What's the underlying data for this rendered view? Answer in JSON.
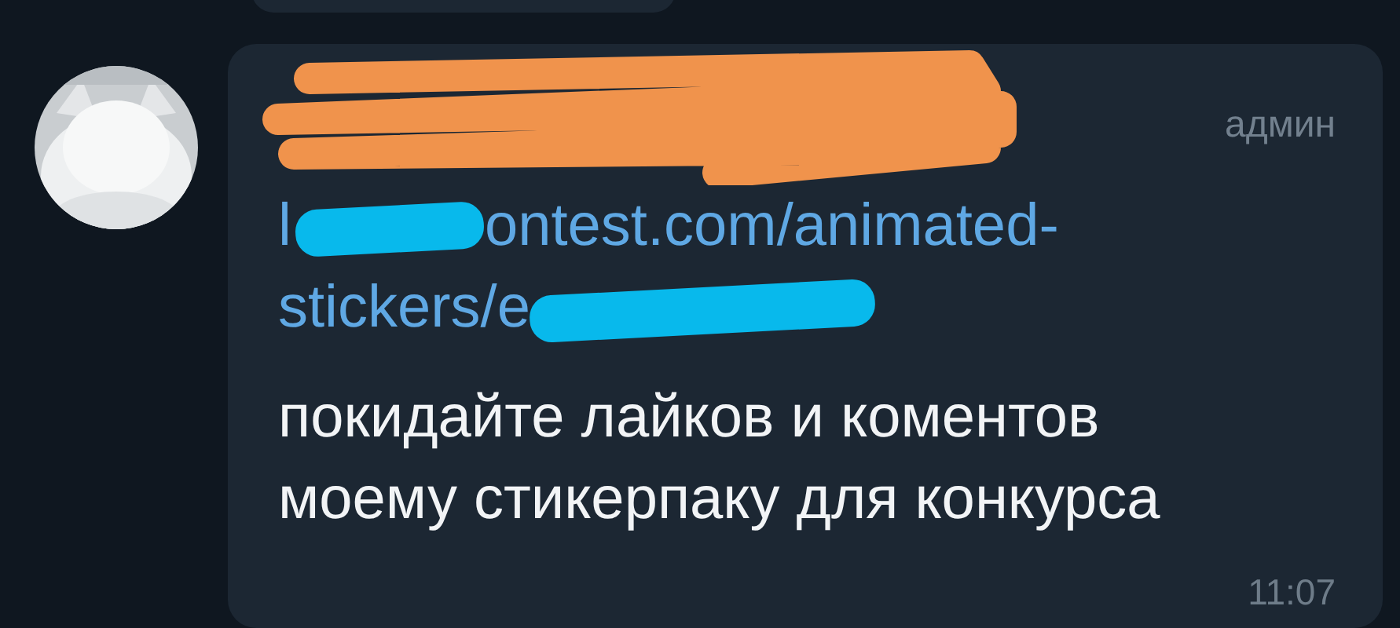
{
  "message": {
    "avatar": {
      "kind": "picture"
    },
    "role": "админ",
    "link_lines": [
      [
        "l",
        "ontest.com/animated-"
      ],
      [
        "stickers/e"
      ]
    ],
    "text": "покидайте лайков и коментов\nмоему стикерпаку для конкурса",
    "time": "11:07"
  }
}
